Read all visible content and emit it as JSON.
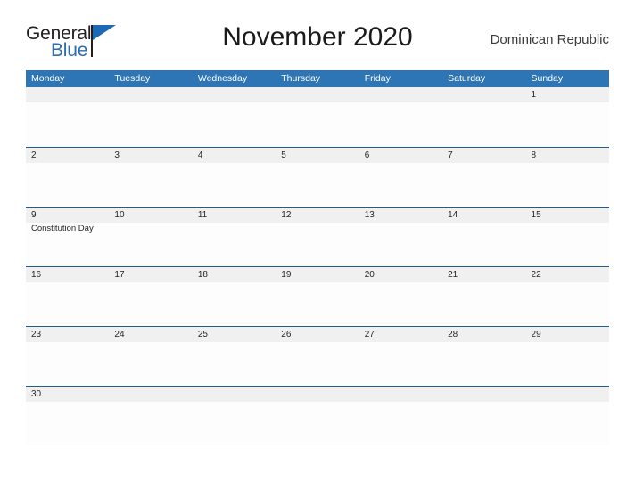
{
  "brand": {
    "name_part1": "General",
    "name_part2": "Blue",
    "flag_icon": "triangle-flag-icon",
    "color_dark": "#231f20",
    "color_blue": "#2b6cb0"
  },
  "header": {
    "title": "November 2020",
    "region": "Dominican Republic"
  },
  "colors": {
    "header_blue": "#2e75b6",
    "divider_blue": "#1f5c99",
    "band_gray": "#f0f0f0",
    "cell_white": "#fdfdfd",
    "text_dark": "#262626"
  },
  "calendar": {
    "weekdays": [
      "Monday",
      "Tuesday",
      "Wednesday",
      "Thursday",
      "Friday",
      "Saturday",
      "Sunday"
    ],
    "weeks": [
      {
        "days": [
          {
            "number": "",
            "event": ""
          },
          {
            "number": "",
            "event": ""
          },
          {
            "number": "",
            "event": ""
          },
          {
            "number": "",
            "event": ""
          },
          {
            "number": "",
            "event": ""
          },
          {
            "number": "",
            "event": ""
          },
          {
            "number": "1",
            "event": ""
          }
        ]
      },
      {
        "days": [
          {
            "number": "2",
            "event": ""
          },
          {
            "number": "3",
            "event": ""
          },
          {
            "number": "4",
            "event": ""
          },
          {
            "number": "5",
            "event": ""
          },
          {
            "number": "6",
            "event": ""
          },
          {
            "number": "7",
            "event": ""
          },
          {
            "number": "8",
            "event": ""
          }
        ]
      },
      {
        "days": [
          {
            "number": "9",
            "event": "Constitution Day"
          },
          {
            "number": "10",
            "event": ""
          },
          {
            "number": "11",
            "event": ""
          },
          {
            "number": "12",
            "event": ""
          },
          {
            "number": "13",
            "event": ""
          },
          {
            "number": "14",
            "event": ""
          },
          {
            "number": "15",
            "event": ""
          }
        ]
      },
      {
        "days": [
          {
            "number": "16",
            "event": ""
          },
          {
            "number": "17",
            "event": ""
          },
          {
            "number": "18",
            "event": ""
          },
          {
            "number": "19",
            "event": ""
          },
          {
            "number": "20",
            "event": ""
          },
          {
            "number": "21",
            "event": ""
          },
          {
            "number": "22",
            "event": ""
          }
        ]
      },
      {
        "days": [
          {
            "number": "23",
            "event": ""
          },
          {
            "number": "24",
            "event": ""
          },
          {
            "number": "25",
            "event": ""
          },
          {
            "number": "26",
            "event": ""
          },
          {
            "number": "27",
            "event": ""
          },
          {
            "number": "28",
            "event": ""
          },
          {
            "number": "29",
            "event": ""
          }
        ]
      },
      {
        "days": [
          {
            "number": "30",
            "event": ""
          },
          {
            "number": "",
            "event": ""
          },
          {
            "number": "",
            "event": ""
          },
          {
            "number": "",
            "event": ""
          },
          {
            "number": "",
            "event": ""
          },
          {
            "number": "",
            "event": ""
          },
          {
            "number": "",
            "event": ""
          }
        ]
      }
    ]
  }
}
